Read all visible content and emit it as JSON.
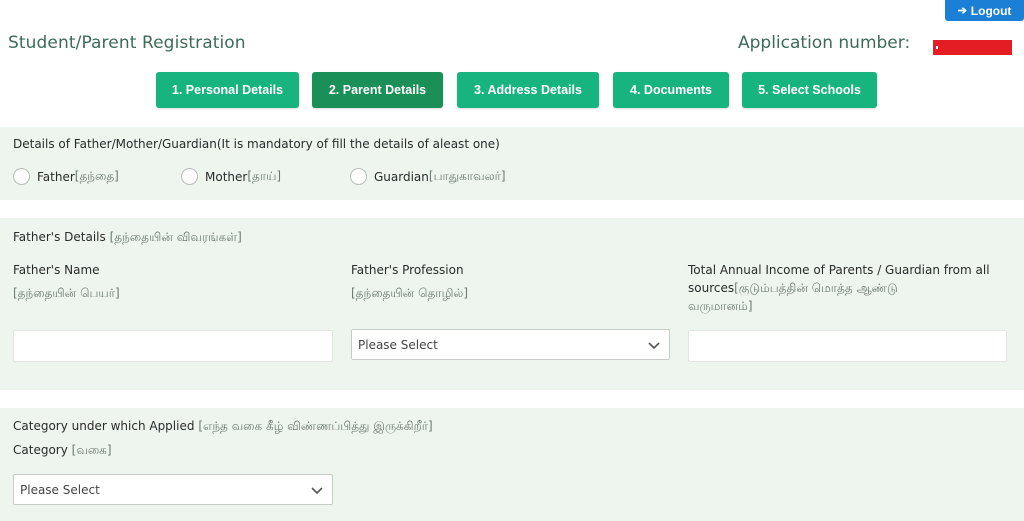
{
  "header": {
    "logout_label": "Logout",
    "logout_icon": "sign-out-icon",
    "page_title": "Student/Parent Registration",
    "application_number_label": "Application number:",
    "application_number_value": ""
  },
  "steps": [
    {
      "label": "1. Personal Details",
      "active": false
    },
    {
      "label": "2. Parent Details",
      "active": true
    },
    {
      "label": "3. Address Details",
      "active": false
    },
    {
      "label": "4. Documents",
      "active": false
    },
    {
      "label": "5. Select Schools",
      "active": false
    }
  ],
  "guardian_type": {
    "heading": "Details of Father/Mother/Guardian(It is mandatory of fill the details of aleast one)",
    "options": [
      {
        "label": "Father",
        "tamil": "[தந்தை]",
        "selected": false
      },
      {
        "label": "Mother",
        "tamil": "[தாய்]",
        "selected": false
      },
      {
        "label": "Guardian",
        "tamil": "[பாதுகாவலர்]",
        "selected": false
      }
    ]
  },
  "father_details": {
    "heading": "Father's Details",
    "heading_tamil": "[தந்தையின் விவரங்கள்]",
    "name": {
      "label": "Father's Name",
      "tamil": "[தந்தையின் பெயர்]",
      "value": ""
    },
    "profession": {
      "label": "Father's Profession",
      "tamil": "[தந்தையின் தொழில்]",
      "selected": "Please Select"
    },
    "income": {
      "label_line1": "Total Annual Income of Parents / Guardian from all",
      "label_line2": "sources",
      "tamil_line2": "[குடும்பத்தின் மொத்த ஆண்டு",
      "tamil_line3": "வருமானம்]",
      "value": ""
    }
  },
  "category": {
    "heading": "Category under which Applied",
    "heading_tamil": "[எந்த வகை கீழ் விண்ணப்பித்து இருக்கிறீர்]",
    "label": "Category",
    "label_tamil": "[வகை]",
    "selected": "Please Select"
  },
  "colors": {
    "step": "#17b47f",
    "step_active": "#1a8f58",
    "logout": "#1b7fd6",
    "title": "#3d6b5a",
    "section_bg": "#eef4ee",
    "redaction": "#e41c24"
  }
}
